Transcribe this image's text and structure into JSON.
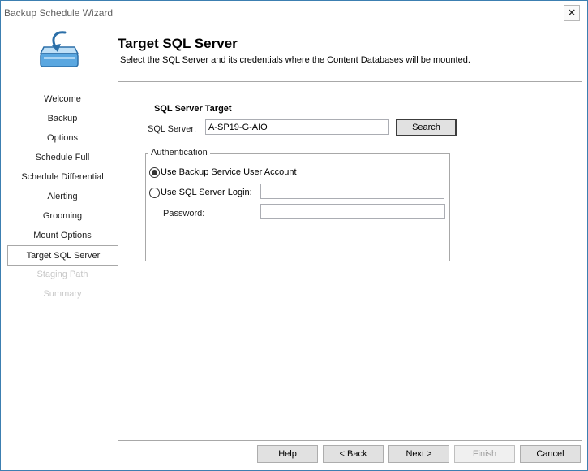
{
  "window": {
    "title": "Backup Schedule Wizard",
    "close_glyph": "✕"
  },
  "header": {
    "title": "Target SQL Server",
    "subtitle": "Select the SQL Server and its credentials where the Content Databases will be mounted."
  },
  "nav": {
    "items": [
      {
        "label": "Welcome",
        "state": "normal"
      },
      {
        "label": "Backup",
        "state": "normal"
      },
      {
        "label": "Options",
        "state": "normal"
      },
      {
        "label": "Schedule Full",
        "state": "normal"
      },
      {
        "label": "Schedule Differential",
        "state": "normal"
      },
      {
        "label": "Alerting",
        "state": "normal"
      },
      {
        "label": "Grooming",
        "state": "normal"
      },
      {
        "label": "Mount Options",
        "state": "normal"
      },
      {
        "label": "Target SQL Server",
        "state": "active"
      },
      {
        "label": "Staging Path",
        "state": "disabled"
      },
      {
        "label": "Summary",
        "state": "disabled"
      }
    ]
  },
  "sql_target": {
    "group_title": "SQL Server Target",
    "server_label": "SQL Server:",
    "server_value": "A-SP19-G-AIO",
    "search_label": "Search"
  },
  "auth": {
    "legend": "Authentication",
    "option_service": "Use Backup Service User Account",
    "option_sql": "Use SQL Server Login:",
    "selected": "service",
    "login_value": "",
    "password_label": "Password:",
    "password_value": ""
  },
  "footer": {
    "help": "Help",
    "back": "< Back",
    "next": "Next >",
    "finish": "Finish",
    "cancel": "Cancel"
  },
  "icons": {
    "logo": "backup-drive-arrow-icon",
    "close": "close-icon"
  },
  "colors": {
    "window_border": "#3c7fb1",
    "logo_blue": "#3d8fd1"
  }
}
